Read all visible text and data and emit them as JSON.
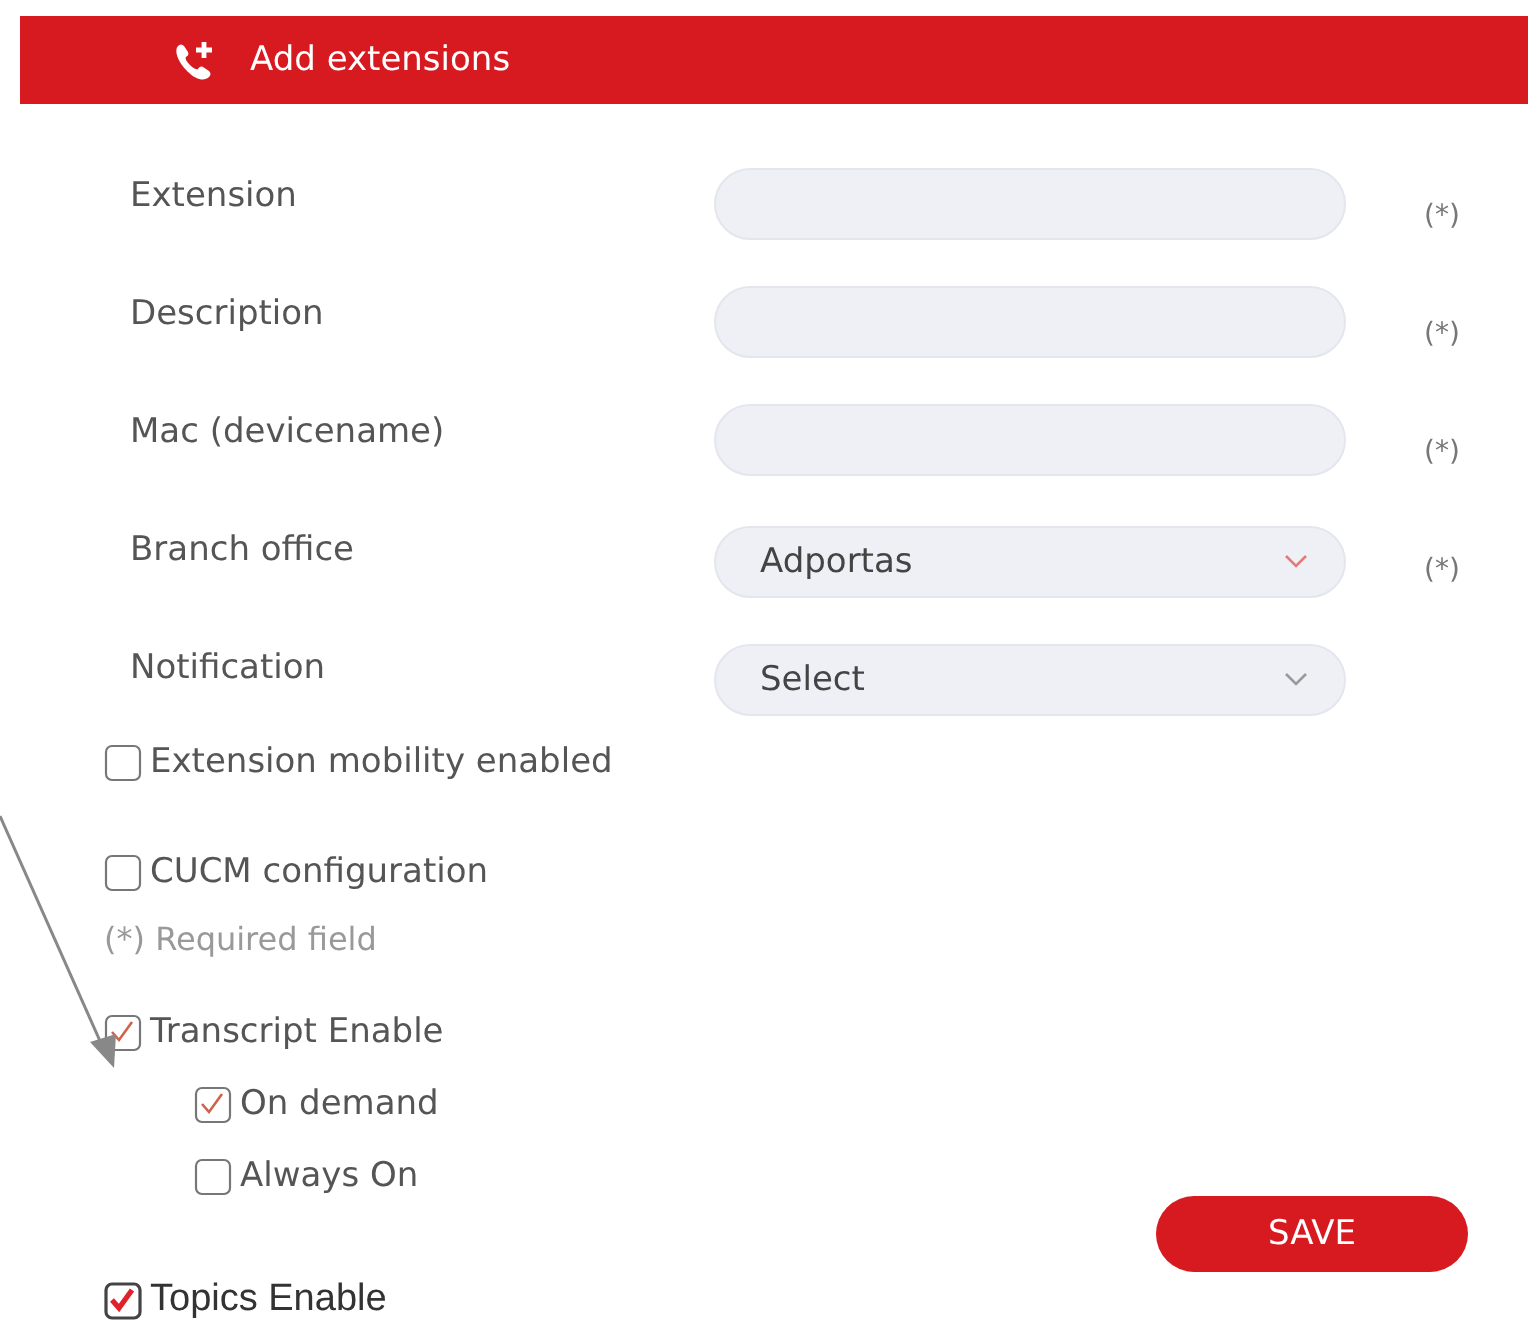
{
  "header": {
    "title": "Add extensions"
  },
  "fields": [
    {
      "label": "Extension",
      "kind": "input",
      "required_mark": "(*)"
    },
    {
      "label": "Description",
      "kind": "input",
      "required_mark": "(*)"
    },
    {
      "label": "Mac (devicename)",
      "kind": "input",
      "required_mark": "(*)"
    },
    {
      "label": "Branch office",
      "kind": "select",
      "value": "Adportas",
      "required_mark": "(*)"
    },
    {
      "label": "Notification",
      "kind": "select",
      "value": "Select"
    }
  ],
  "options": [
    {
      "label": "Extension mobility enabled",
      "checked": false
    },
    {
      "label": "CUCM configuration",
      "checked": false
    }
  ],
  "required_note": "(*) Required field",
  "transcript": [
    {
      "label": "Transcript Enable",
      "checked": true,
      "children": [
        {
          "label": "On demand",
          "checked": true
        },
        {
          "label": "Always On",
          "checked": false
        }
      ]
    }
  ],
  "topics": {
    "label": "Topics Enable",
    "checked": true
  },
  "save_button": "SAVE"
}
